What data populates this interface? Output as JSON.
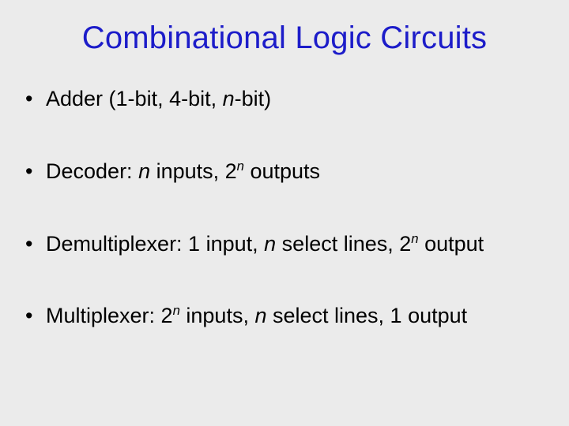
{
  "title": "Combinational Logic Circuits",
  "bullets": {
    "b0": {
      "t0": "Adder (1-bit, 4-bit, ",
      "i0": "n",
      "t1": "-bit)"
    },
    "b1": {
      "t0": "Decoder: ",
      "i0": "n",
      "t1": " inputs, 2",
      "sup0": "n",
      "t2": " outputs"
    },
    "b2": {
      "t0": "Demultiplexer: 1 input, ",
      "i0": "n",
      "t1": " select lines, 2",
      "sup0": "n",
      "t2": " output"
    },
    "b3": {
      "t0": "Multiplexer: 2",
      "sup0": "n",
      "t1": " inputs, ",
      "i0": "n",
      "t2": " select lines, 1 output"
    }
  }
}
